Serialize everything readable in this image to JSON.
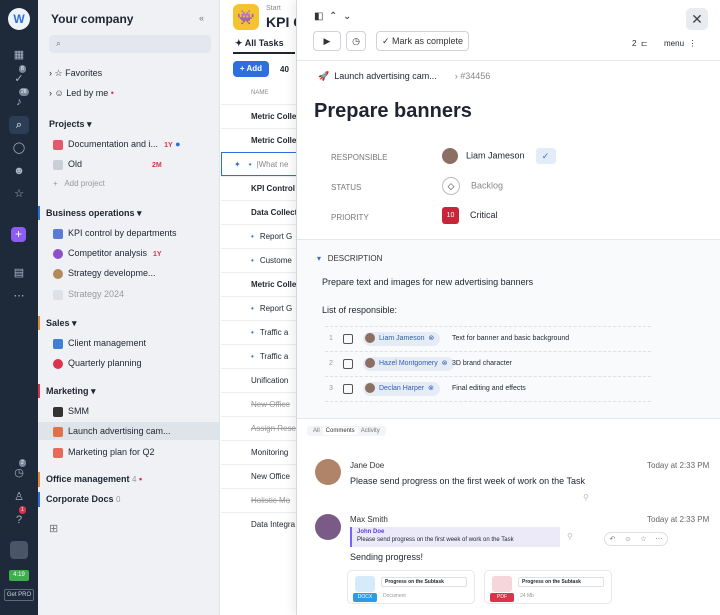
{
  "rail": {
    "logo": "W",
    "badges": {
      "tasks": "8",
      "notifications": "28",
      "clock": "2",
      "help": "1"
    },
    "time": "4:19",
    "pro": "Get PRO"
  },
  "sidebar": {
    "title": "Your company",
    "collapse_icon": "«",
    "search_placeholder": "",
    "favorites": "Favorites",
    "led_by_me": "Led by me",
    "projects_label": "Projects",
    "projects": [
      {
        "label": "Documentation and i...",
        "tag": "1Y"
      },
      {
        "label": "Old",
        "tag": "2M"
      },
      {
        "label": "Add project"
      }
    ],
    "groups": [
      {
        "label": "Business operations",
        "items": [
          {
            "label": "KPI control by departments"
          },
          {
            "label": "Competitor analysis",
            "tag": "1Y"
          },
          {
            "label": "Strategy developme..."
          },
          {
            "label": "Strategy 2024"
          }
        ]
      },
      {
        "label": "Sales",
        "items": [
          {
            "label": "Client management"
          },
          {
            "label": "Quarterly planning"
          }
        ]
      },
      {
        "label": "Marketing",
        "items": [
          {
            "label": "SMM"
          },
          {
            "label": "Launch advertising cam..."
          },
          {
            "label": "Marketing plan for Q2"
          }
        ]
      },
      {
        "label": "Office management",
        "count": "4"
      },
      {
        "label": "Corporate Docs",
        "count": "0"
      }
    ]
  },
  "tasklist": {
    "start": "Start",
    "title": "KPI C",
    "tab": "All Tasks",
    "add": "Add",
    "count": "40",
    "col_name": "NAME",
    "rows": [
      "Metric Colle",
      "Metric Colle",
      "|What ne",
      "KPI Control",
      "Data Collect",
      "Report G",
      "Custome",
      "Metric Colle",
      "Report G",
      "Traffic a",
      "Traffic a",
      "Unification",
      "New Office",
      "Assign Rese",
      "Monitoring",
      "New Office",
      "Holistic Mo",
      "Data Integra"
    ]
  },
  "detail": {
    "mark_complete": "Mark as complete",
    "count": "2",
    "menu": "menu",
    "breadcrumb": "Launch advertising cam...",
    "task_id": "#34456",
    "title": "Prepare banners",
    "fields": {
      "responsible_label": "RESPONSIBLE",
      "responsible": "Liam Jameson",
      "status_label": "STATUS",
      "status": "Backlog",
      "priority_label": "PRIORITY",
      "priority_num": "10",
      "priority": "Critical"
    },
    "description_label": "DESCRIPTION",
    "description": "Prepare text and images for new advertising banners",
    "list_title": "List of responsible:",
    "list": [
      {
        "n": "1",
        "person": "Liam Jameson",
        "task": "Text for banner and basic background"
      },
      {
        "n": "2",
        "person": "Hazel Montgomery",
        "task": "3D brand character"
      },
      {
        "n": "3",
        "person": "Declan Harper",
        "task": "Final editing and effects"
      }
    ],
    "tabs": [
      "All",
      "Comments",
      "Activity"
    ],
    "comments": [
      {
        "author": "Jane Doe",
        "time": "Today at 2:33 PM",
        "text": "Please send progress on the first week of work on the Task"
      },
      {
        "author": "Max Smith",
        "time": "Today at 2:33 PM",
        "quote_author": "John Doe",
        "quote": "Please send progress on the first week of work on the Task",
        "text": "Sending progress!"
      }
    ],
    "files": [
      {
        "name": "Progress on the Subtask",
        "ext": "DOCX",
        "kind": "Document",
        "color": "#2f9be0"
      },
      {
        "name": "Progress on the Subtask",
        "ext": "PDF",
        "kind": "24 Mb",
        "color": "#d9344c"
      }
    ]
  }
}
